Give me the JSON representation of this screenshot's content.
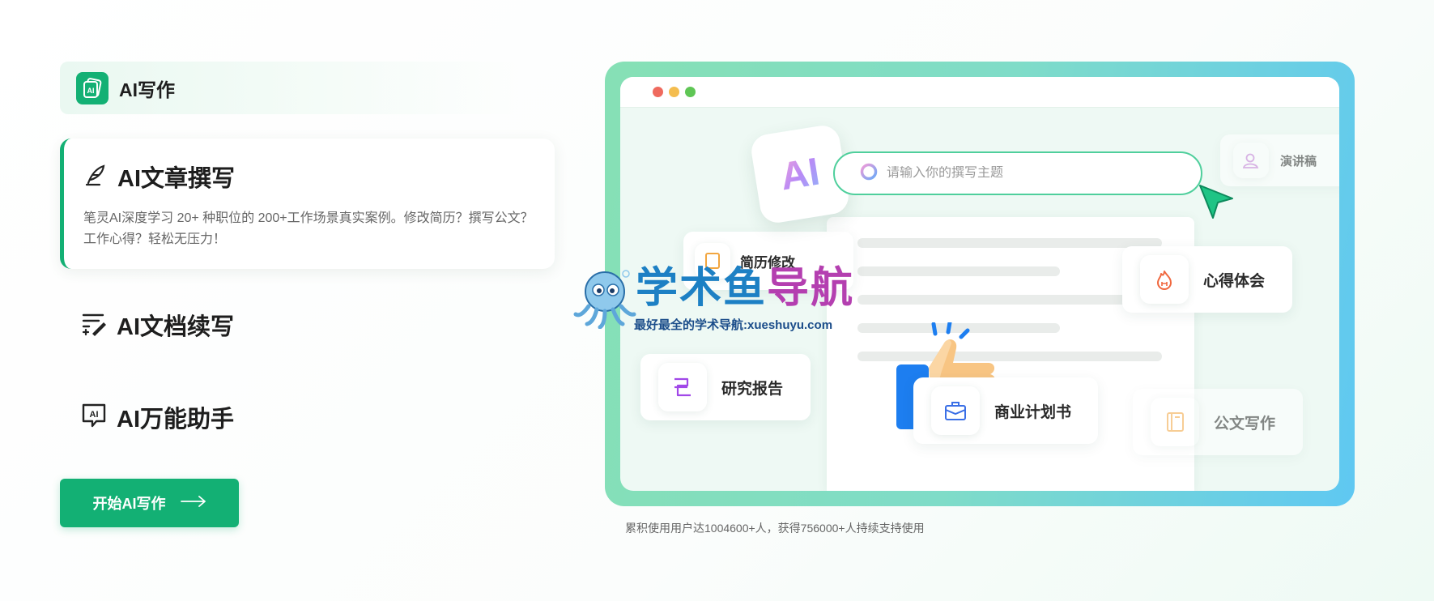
{
  "brand": {
    "title": "AI写作",
    "logo_icon": "ai-card-icon"
  },
  "featured": {
    "title": "AI文章撰写",
    "icon": "quill-pen-icon",
    "description": "笔灵AI深度学习 20+ 种职位的 200+工作场景真实案例。修改简历？撰写公文？工作心得？轻松无压力！"
  },
  "features": [
    {
      "label": "AI文档续写",
      "icon": "doc-continue-icon"
    },
    {
      "label": "AI万能助手",
      "icon": "ai-assistant-icon"
    }
  ],
  "cta": {
    "label": "开始AI写作",
    "icon": "arrow-right-icon"
  },
  "illustration": {
    "badge_text": "AI",
    "search_placeholder": "请输入你的撰写主题",
    "chips": {
      "speech": "演讲稿",
      "experience": "心得体会",
      "research": "研究报告",
      "business": "商业计划书",
      "official": "公文写作",
      "resume": "简历修改"
    }
  },
  "stats": "累积使用用户达1004600+人，获得756000+人持续支持使用",
  "watermark": {
    "title_a": "学术鱼",
    "title_b": "导航",
    "subtitle": "最好最全的学术导航:xueshuyu.com"
  },
  "colors": {
    "accent": "#13b074",
    "frame_start": "#86e0b5",
    "frame_end": "#5fc8f2",
    "dot_red": "#ef6a5e",
    "dot_yellow": "#f4bd4f",
    "dot_green": "#5fc655"
  }
}
